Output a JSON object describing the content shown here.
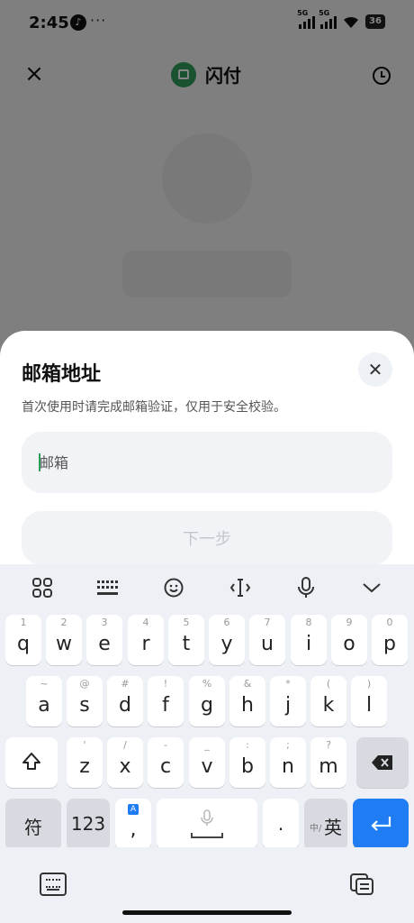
{
  "status_bar": {
    "time": "2:45",
    "dots": "···",
    "net1": "5G",
    "net2": "5G",
    "battery": "36"
  },
  "header": {
    "brand_name": "闪付"
  },
  "sheet": {
    "title": "邮箱地址",
    "description": "首次使用时请完成邮箱验证，仅用于安全校验。",
    "email_placeholder": "邮箱",
    "next_label": "下一步"
  },
  "keyboard": {
    "row1": [
      {
        "k": "q",
        "s": "1"
      },
      {
        "k": "w",
        "s": "2"
      },
      {
        "k": "e",
        "s": "3"
      },
      {
        "k": "r",
        "s": "4"
      },
      {
        "k": "t",
        "s": "5"
      },
      {
        "k": "y",
        "s": "6"
      },
      {
        "k": "u",
        "s": "7"
      },
      {
        "k": "i",
        "s": "8"
      },
      {
        "k": "o",
        "s": "9"
      },
      {
        "k": "p",
        "s": "0"
      }
    ],
    "row2": [
      {
        "k": "a",
        "s": "~"
      },
      {
        "k": "s",
        "s": "@"
      },
      {
        "k": "d",
        "s": "#"
      },
      {
        "k": "f",
        "s": "!"
      },
      {
        "k": "g",
        "s": "%"
      },
      {
        "k": "h",
        "s": "&"
      },
      {
        "k": "j",
        "s": "*"
      },
      {
        "k": "k",
        "s": "("
      },
      {
        "k": "l",
        "s": ")"
      }
    ],
    "row3": [
      {
        "k": "z",
        "s": "'"
      },
      {
        "k": "x",
        "s": "/"
      },
      {
        "k": "c",
        "s": "-"
      },
      {
        "k": "v",
        "s": "_"
      },
      {
        "k": "b",
        "s": ":"
      },
      {
        "k": "n",
        "s": ";"
      },
      {
        "k": "m",
        "s": "?"
      }
    ],
    "symbol_label": "符",
    "number_label": "123",
    "comma_label": ",",
    "comma_badge": "A",
    "period_label": ".",
    "lang_label": "英",
    "lang_sub": "中/"
  }
}
